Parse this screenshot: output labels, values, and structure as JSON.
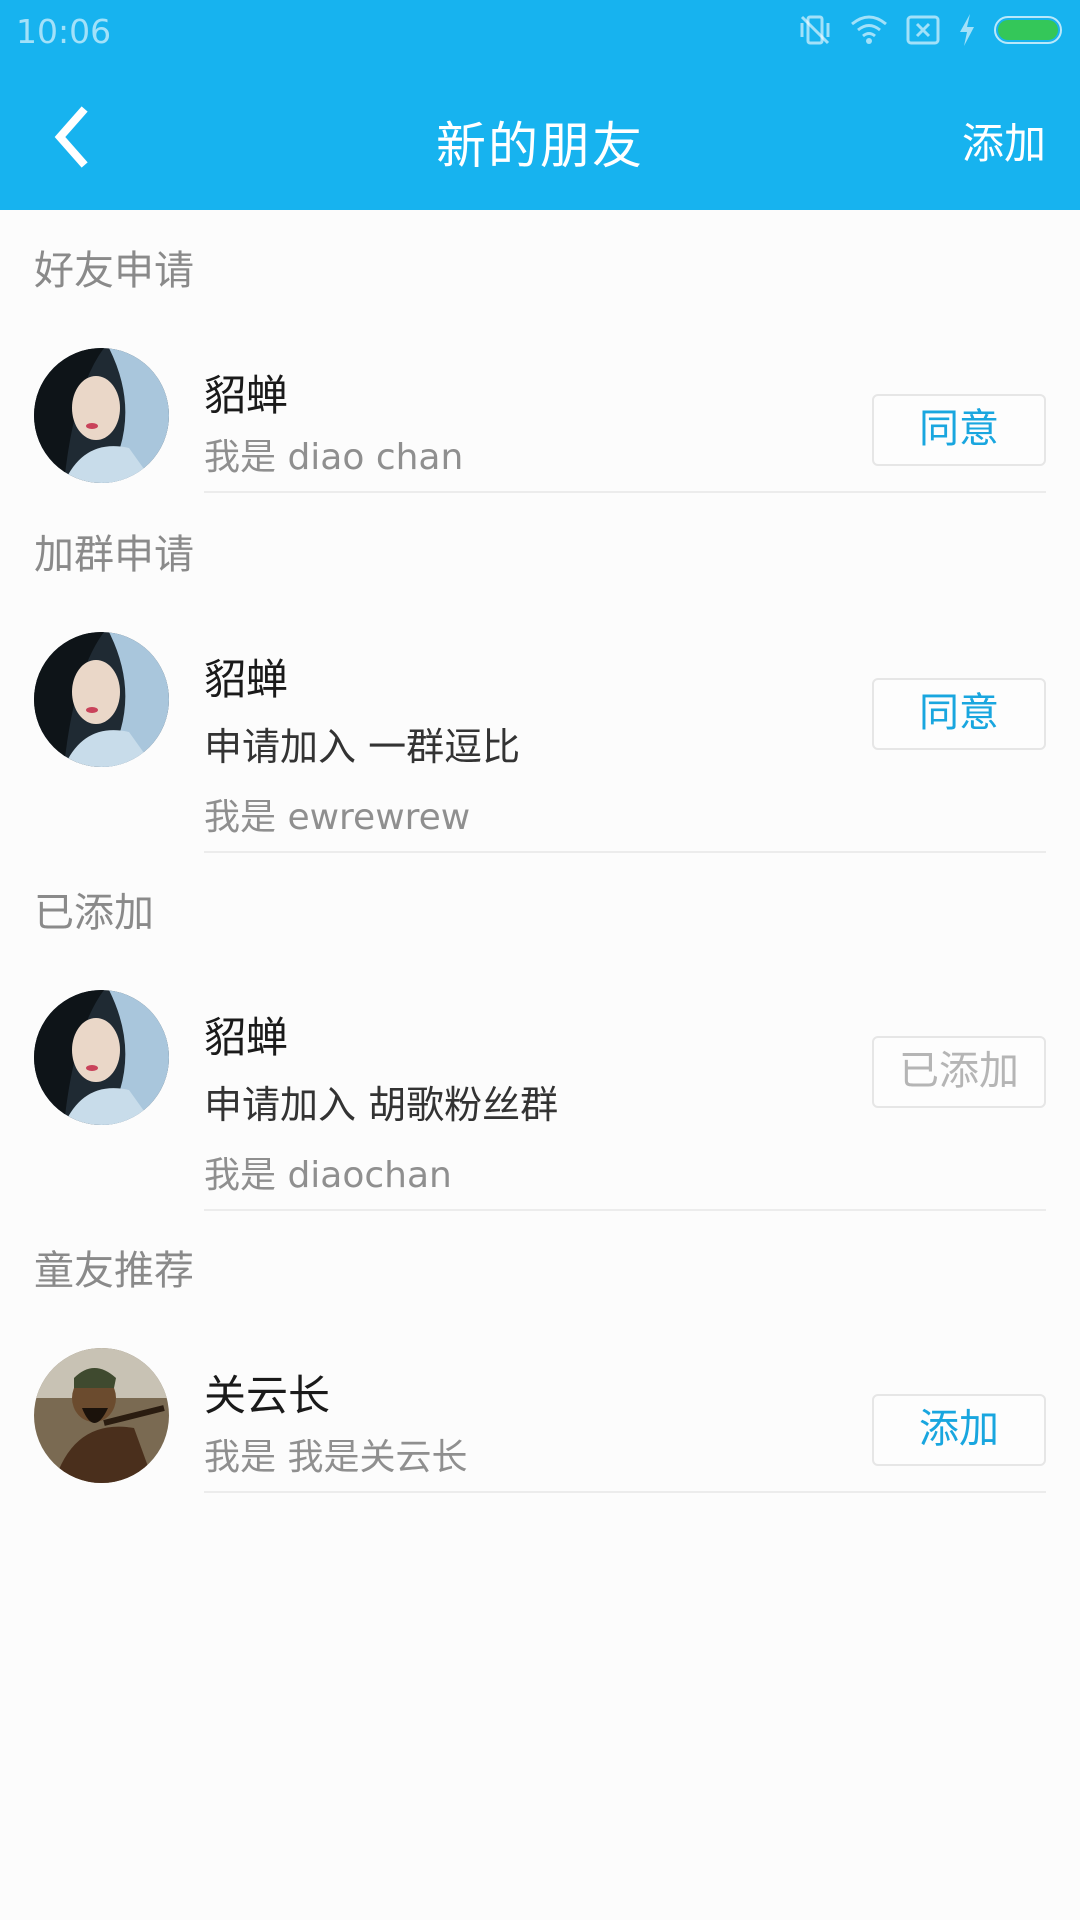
{
  "status": {
    "time": "10:06"
  },
  "header": {
    "title": "新的朋友",
    "action_label": "添加"
  },
  "sections": {
    "friend_requests": {
      "title": "好友申请",
      "items": [
        {
          "name": "貂蝉",
          "message": "我是 diao chan",
          "button": "同意"
        }
      ]
    },
    "group_requests": {
      "title": "加群申请",
      "items": [
        {
          "name": "貂蝉",
          "group_line": "申请加入 一群逗比",
          "message": "我是 ewrewrew",
          "button": "同意"
        }
      ]
    },
    "added": {
      "title": "已添加",
      "items": [
        {
          "name": "貂蝉",
          "group_line": "申请加入 胡歌粉丝群",
          "message": "我是 diaochan",
          "button": "已添加"
        }
      ]
    },
    "recommended": {
      "title": "童友推荐",
      "items": [
        {
          "name": "关云长",
          "message": "我是 我是关云长",
          "button": "添加"
        }
      ]
    }
  },
  "icons": [
    "back-icon",
    "vibrate-off-icon",
    "wifi-icon",
    "no-sim-icon",
    "charging-icon",
    "battery-icon"
  ],
  "colors": {
    "accent": "#17b3ef",
    "button_text": "#19a6df",
    "battery": "#34c759"
  }
}
